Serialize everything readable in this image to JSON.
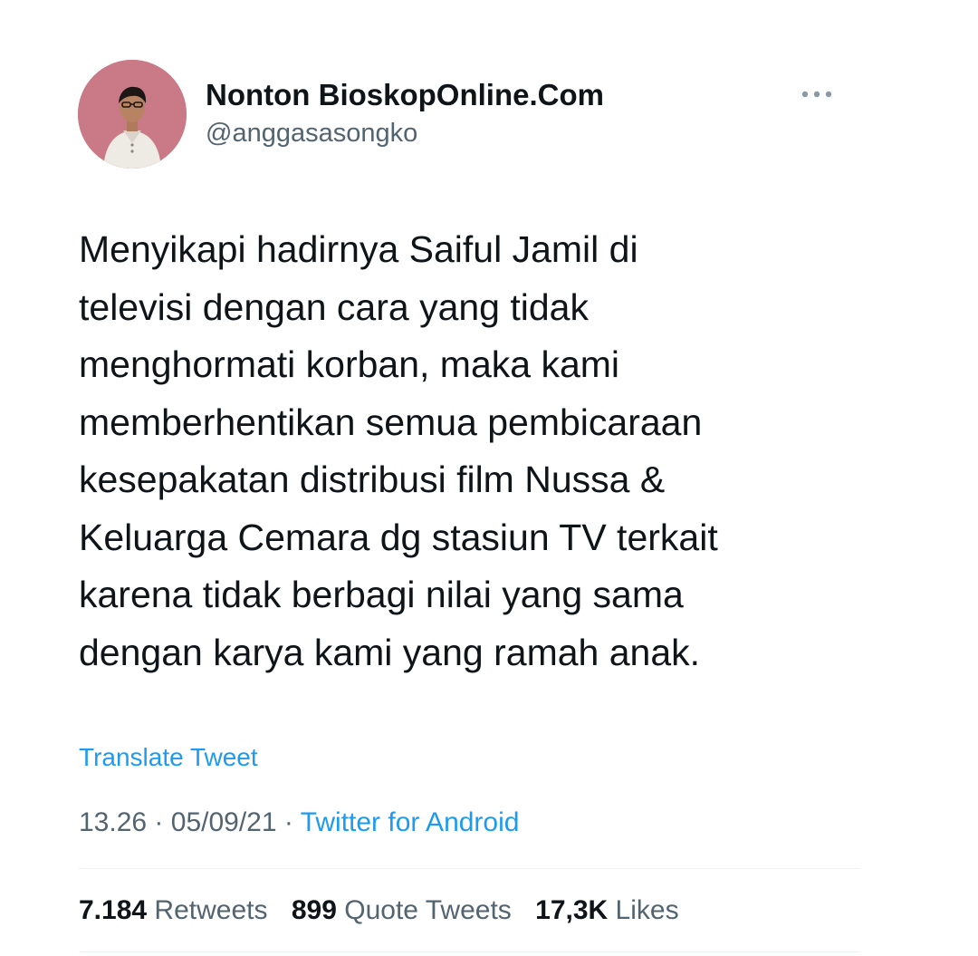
{
  "author": {
    "display_name": "Nonton BioskopOnline.Com",
    "handle": "@anggasasongko"
  },
  "tweet": {
    "lines": [
      "Menyikapi hadirnya Saiful Jamil di",
      "televisi dengan cara yang tidak",
      "menghormati korban, maka kami",
      "memberhentikan semua pembicaraan",
      "kesepakatan distribusi film Nussa &",
      "Keluarga Cemara dg stasiun TV terkait",
      "karena tidak berbagi nilai yang sama",
      "dengan karya kami yang ramah anak."
    ],
    "translate_label": "Translate Tweet"
  },
  "meta": {
    "time": "13.26",
    "separator": "·",
    "date": "05/09/21",
    "source": "Twitter for Android"
  },
  "stats": {
    "retweets_count": "7.184",
    "retweets_label": "Retweets",
    "quotes_count": "899",
    "quotes_label": "Quote Tweets",
    "likes_count": "17,3K",
    "likes_label": "Likes"
  },
  "icons": {
    "more": "more-options-icon"
  },
  "colors": {
    "link": "#1d9bf0",
    "secondary_text": "#536471",
    "primary_text": "#0f1419",
    "avatar_bg": "#c97a86"
  }
}
